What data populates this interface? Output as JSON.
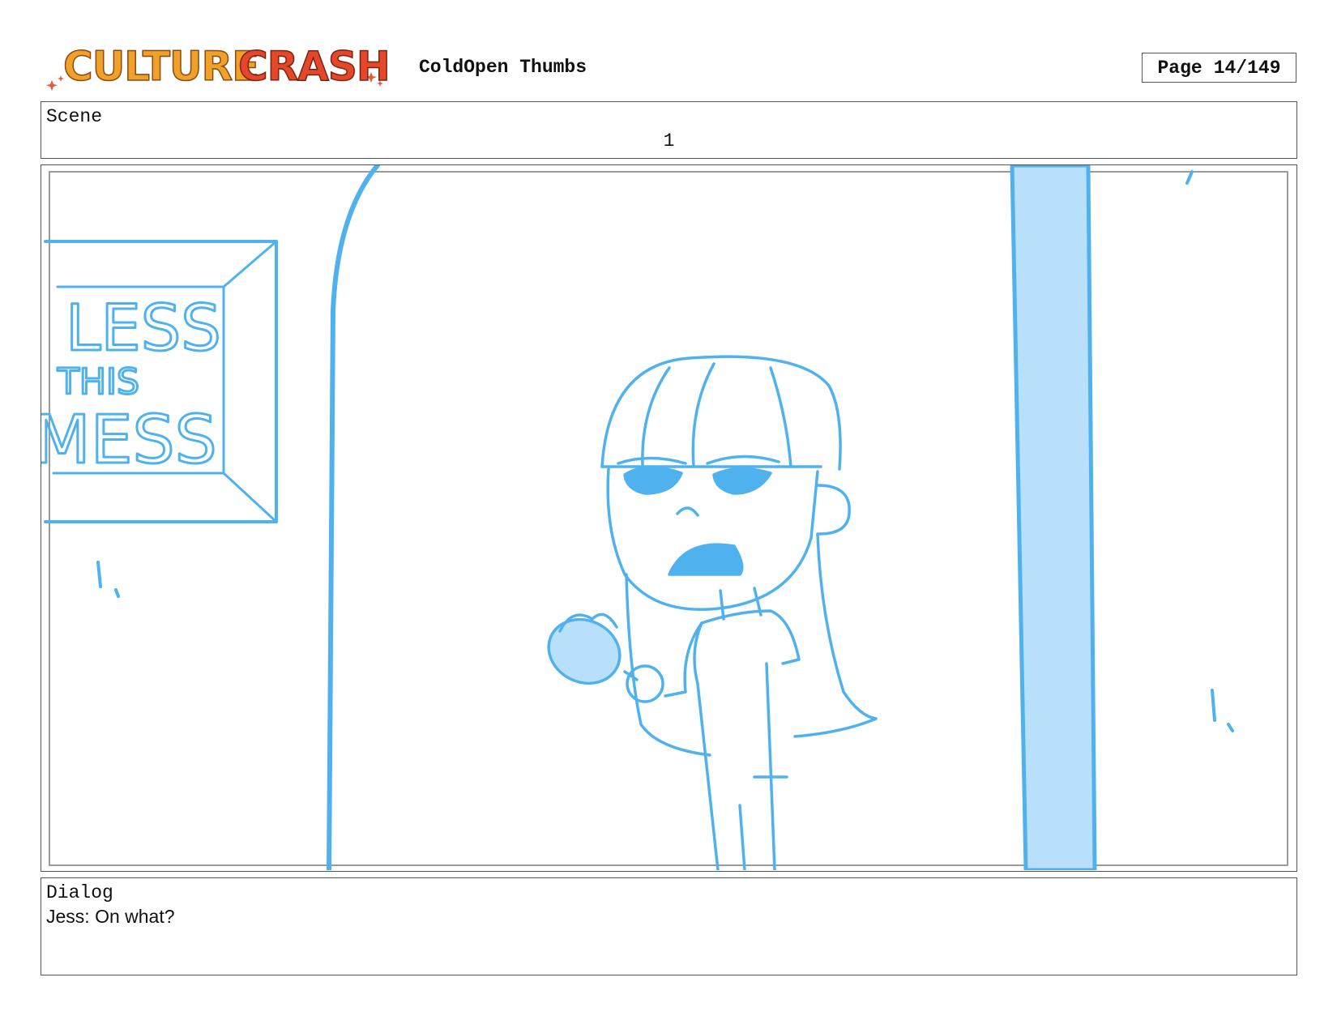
{
  "header": {
    "logo_text": "CULTURE CRASH",
    "title": "ColdOpen Thumbs",
    "page_label": "Page",
    "page_value": "14/149"
  },
  "scene": {
    "label": "Scene",
    "number": "1"
  },
  "panel": {
    "sign_lines": [
      "LESS",
      "THIS",
      "MESS"
    ],
    "sketch_color": "#4fb2ee",
    "sketch_fill": "#b9e0fa"
  },
  "dialog": {
    "label": "Dialog",
    "text": "Jess: On what?"
  },
  "colors": {
    "logo_orange": "#f0a12a",
    "logo_red": "#e5472a",
    "border": "#555555"
  }
}
